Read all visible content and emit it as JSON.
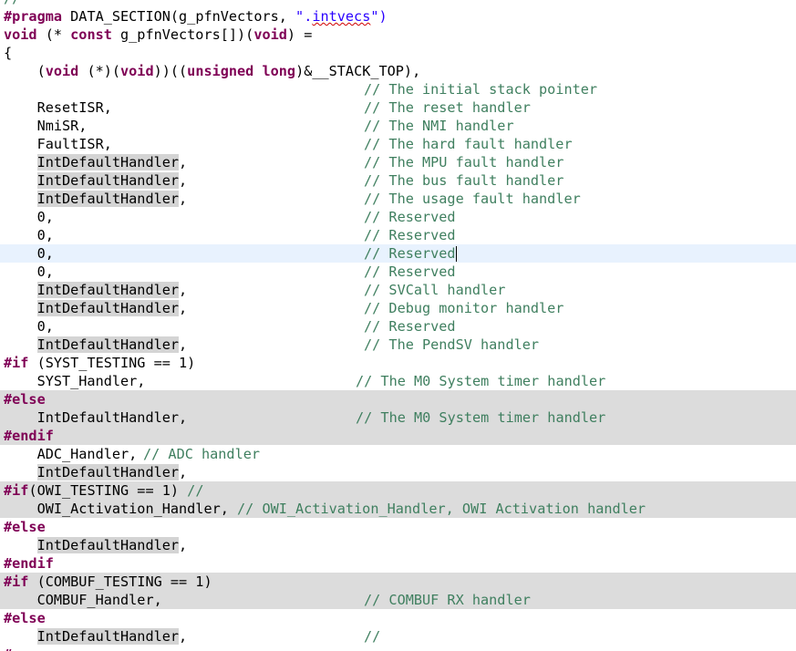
{
  "editor": {
    "top_fragment": "//",
    "l1": {
      "pragma": "#pragma",
      "a": " DATA_SECTION(g_pfnVectors, ",
      "q1": "\".",
      "str": "intvecs",
      "q2": "\")"
    },
    "l2": {
      "void": "void",
      "a": " (* ",
      "const": "const",
      "b": " g_pfnVectors[])(",
      "void2": "void",
      "c": ") ="
    },
    "l3": {
      "code": "{"
    },
    "l4": {
      "a": "    (",
      "void": "void",
      "b": " (*)(",
      "void2": "void",
      "c": "))((",
      "unsigned": "unsigned",
      "sp": " ",
      "long": "long",
      "d": ")&__STACK_TOP),"
    },
    "l5": {
      "comment": "// The initial stack pointer"
    },
    "l6": {
      "code": "    ResetISR,",
      "comment": "// The reset handler"
    },
    "l7": {
      "code": "    NmiSR,",
      "comment": "// The NMI handler"
    },
    "l8": {
      "code": "    FaultISR,",
      "comment": "// The hard fault handler"
    },
    "l9": {
      "indent": "    ",
      "handler": "IntDefaultHandler",
      "rest": ",",
      "comment": "// The MPU fault handler"
    },
    "l10": {
      "indent": "    ",
      "handler": "IntDefaultHandler",
      "rest": ",",
      "comment": "// The bus fault handler"
    },
    "l11": {
      "indent": "    ",
      "handler": "IntDefaultHandler",
      "rest": ",",
      "comment": "// The usage fault handler"
    },
    "l12": {
      "code": "    0,",
      "comment": "// Reserved"
    },
    "l13": {
      "code": "    0,",
      "comment": "// Reserved"
    },
    "l14": {
      "code": "    0,",
      "comment": "// Reserved"
    },
    "l15": {
      "code": "    0,",
      "comment": "// Reserved"
    },
    "l16": {
      "indent": "    ",
      "handler": "IntDefaultHandler",
      "rest": ",",
      "comment": "// SVCall handler"
    },
    "l17": {
      "indent": "    ",
      "handler": "IntDefaultHandler",
      "rest": ",",
      "comment": "// Debug monitor handler"
    },
    "l18": {
      "code": "    0,",
      "comment": "// Reserved"
    },
    "l19": {
      "indent": "    ",
      "handler": "IntDefaultHandler",
      "rest": ",",
      "comment": "// The PendSV handler"
    },
    "l20": {
      "kw": "#if",
      "rest": " (SYST_TESTING == 1)"
    },
    "l21": {
      "code": "    SYST_Handler,",
      "comment": "// The M0 System timer handler"
    },
    "l22": {
      "kw": "#else"
    },
    "l23": {
      "code": "    IntDefaultHandler,",
      "comment": "// The M0 System timer handler"
    },
    "l24": {
      "kw": "#endif"
    },
    "l25": {
      "code": "    ADC_Handler,",
      "comment": "// ADC handler"
    },
    "l26": {
      "indent": "    ",
      "handler": "IntDefaultHandler",
      "rest": ","
    },
    "l27": {
      "kw": "#if",
      "rest": "(OWI_TESTING == 1) ",
      "comment": "//"
    },
    "l28": {
      "code": "    OWI_Activation_Handler, ",
      "comment": "// OWI_Activation_Handler, OWI Activation handler"
    },
    "l29": {
      "kw": "#else"
    },
    "l30": {
      "indent": "    ",
      "handler": "IntDefaultHandler",
      "rest": ","
    },
    "l31": {
      "kw": "#endif"
    },
    "l32": {
      "kw": "#if",
      "rest": " (COMBUF_TESTING == 1)"
    },
    "l33": {
      "code": "    COMBUF_Handler,",
      "comment": "// COMBUF RX handler"
    },
    "l34": {
      "kw": "#else"
    },
    "l35": {
      "indent": "    ",
      "handler": "IntDefaultHandler",
      "rest": ",",
      "comment": "//"
    },
    "bottom_fragment": "#   "
  }
}
